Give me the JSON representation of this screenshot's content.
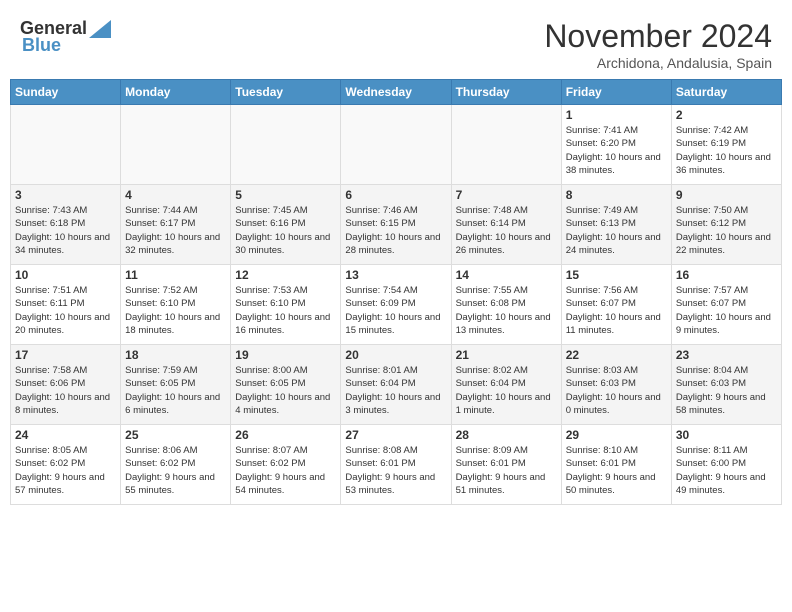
{
  "header": {
    "logo_line1": "General",
    "logo_line2": "Blue",
    "month": "November 2024",
    "location": "Archidona, Andalusia, Spain"
  },
  "days_of_week": [
    "Sunday",
    "Monday",
    "Tuesday",
    "Wednesday",
    "Thursday",
    "Friday",
    "Saturday"
  ],
  "weeks": [
    {
      "days": [
        {
          "number": "",
          "info": ""
        },
        {
          "number": "",
          "info": ""
        },
        {
          "number": "",
          "info": ""
        },
        {
          "number": "",
          "info": ""
        },
        {
          "number": "",
          "info": ""
        },
        {
          "number": "1",
          "info": "Sunrise: 7:41 AM\nSunset: 6:20 PM\nDaylight: 10 hours and 38 minutes."
        },
        {
          "number": "2",
          "info": "Sunrise: 7:42 AM\nSunset: 6:19 PM\nDaylight: 10 hours and 36 minutes."
        }
      ]
    },
    {
      "days": [
        {
          "number": "3",
          "info": "Sunrise: 7:43 AM\nSunset: 6:18 PM\nDaylight: 10 hours and 34 minutes."
        },
        {
          "number": "4",
          "info": "Sunrise: 7:44 AM\nSunset: 6:17 PM\nDaylight: 10 hours and 32 minutes."
        },
        {
          "number": "5",
          "info": "Sunrise: 7:45 AM\nSunset: 6:16 PM\nDaylight: 10 hours and 30 minutes."
        },
        {
          "number": "6",
          "info": "Sunrise: 7:46 AM\nSunset: 6:15 PM\nDaylight: 10 hours and 28 minutes."
        },
        {
          "number": "7",
          "info": "Sunrise: 7:48 AM\nSunset: 6:14 PM\nDaylight: 10 hours and 26 minutes."
        },
        {
          "number": "8",
          "info": "Sunrise: 7:49 AM\nSunset: 6:13 PM\nDaylight: 10 hours and 24 minutes."
        },
        {
          "number": "9",
          "info": "Sunrise: 7:50 AM\nSunset: 6:12 PM\nDaylight: 10 hours and 22 minutes."
        }
      ]
    },
    {
      "days": [
        {
          "number": "10",
          "info": "Sunrise: 7:51 AM\nSunset: 6:11 PM\nDaylight: 10 hours and 20 minutes."
        },
        {
          "number": "11",
          "info": "Sunrise: 7:52 AM\nSunset: 6:10 PM\nDaylight: 10 hours and 18 minutes."
        },
        {
          "number": "12",
          "info": "Sunrise: 7:53 AM\nSunset: 6:10 PM\nDaylight: 10 hours and 16 minutes."
        },
        {
          "number": "13",
          "info": "Sunrise: 7:54 AM\nSunset: 6:09 PM\nDaylight: 10 hours and 15 minutes."
        },
        {
          "number": "14",
          "info": "Sunrise: 7:55 AM\nSunset: 6:08 PM\nDaylight: 10 hours and 13 minutes."
        },
        {
          "number": "15",
          "info": "Sunrise: 7:56 AM\nSunset: 6:07 PM\nDaylight: 10 hours and 11 minutes."
        },
        {
          "number": "16",
          "info": "Sunrise: 7:57 AM\nSunset: 6:07 PM\nDaylight: 10 hours and 9 minutes."
        }
      ]
    },
    {
      "days": [
        {
          "number": "17",
          "info": "Sunrise: 7:58 AM\nSunset: 6:06 PM\nDaylight: 10 hours and 8 minutes."
        },
        {
          "number": "18",
          "info": "Sunrise: 7:59 AM\nSunset: 6:05 PM\nDaylight: 10 hours and 6 minutes."
        },
        {
          "number": "19",
          "info": "Sunrise: 8:00 AM\nSunset: 6:05 PM\nDaylight: 10 hours and 4 minutes."
        },
        {
          "number": "20",
          "info": "Sunrise: 8:01 AM\nSunset: 6:04 PM\nDaylight: 10 hours and 3 minutes."
        },
        {
          "number": "21",
          "info": "Sunrise: 8:02 AM\nSunset: 6:04 PM\nDaylight: 10 hours and 1 minute."
        },
        {
          "number": "22",
          "info": "Sunrise: 8:03 AM\nSunset: 6:03 PM\nDaylight: 10 hours and 0 minutes."
        },
        {
          "number": "23",
          "info": "Sunrise: 8:04 AM\nSunset: 6:03 PM\nDaylight: 9 hours and 58 minutes."
        }
      ]
    },
    {
      "days": [
        {
          "number": "24",
          "info": "Sunrise: 8:05 AM\nSunset: 6:02 PM\nDaylight: 9 hours and 57 minutes."
        },
        {
          "number": "25",
          "info": "Sunrise: 8:06 AM\nSunset: 6:02 PM\nDaylight: 9 hours and 55 minutes."
        },
        {
          "number": "26",
          "info": "Sunrise: 8:07 AM\nSunset: 6:02 PM\nDaylight: 9 hours and 54 minutes."
        },
        {
          "number": "27",
          "info": "Sunrise: 8:08 AM\nSunset: 6:01 PM\nDaylight: 9 hours and 53 minutes."
        },
        {
          "number": "28",
          "info": "Sunrise: 8:09 AM\nSunset: 6:01 PM\nDaylight: 9 hours and 51 minutes."
        },
        {
          "number": "29",
          "info": "Sunrise: 8:10 AM\nSunset: 6:01 PM\nDaylight: 9 hours and 50 minutes."
        },
        {
          "number": "30",
          "info": "Sunrise: 8:11 AM\nSunset: 6:00 PM\nDaylight: 9 hours and 49 minutes."
        }
      ]
    }
  ]
}
